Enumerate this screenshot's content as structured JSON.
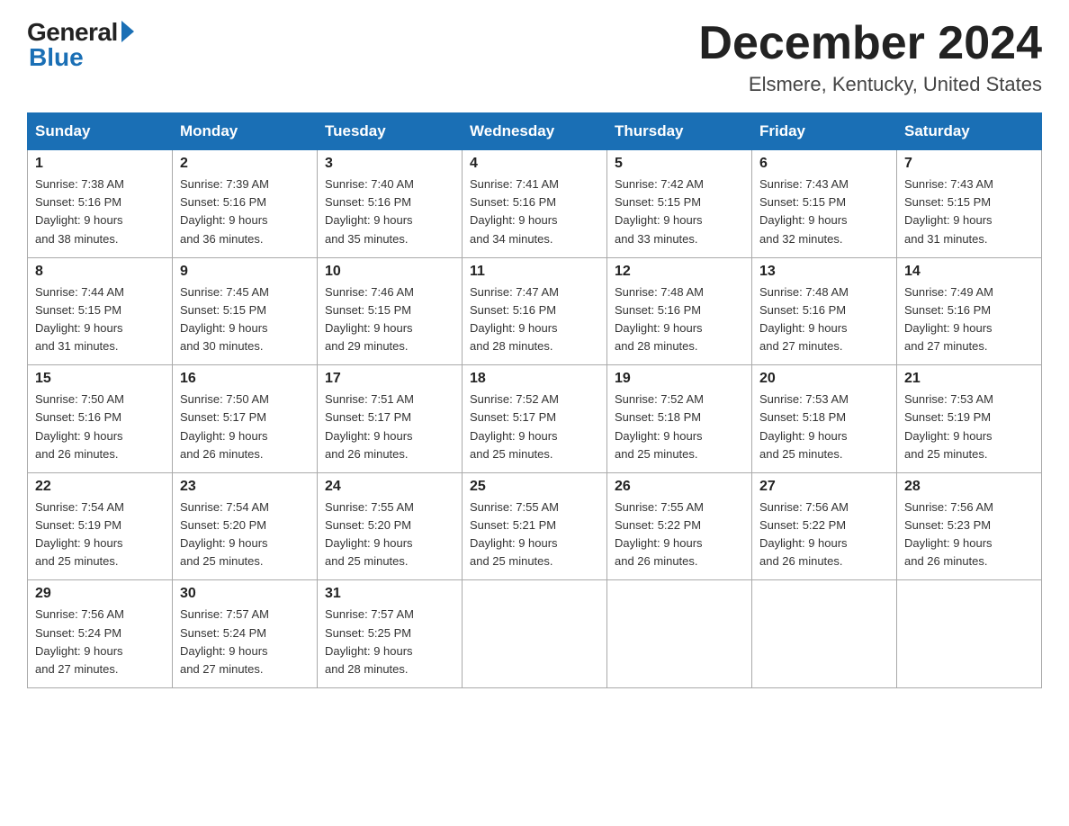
{
  "header": {
    "logo": {
      "general": "General",
      "blue": "Blue"
    },
    "month": "December 2024",
    "location": "Elsmere, Kentucky, United States"
  },
  "days_of_week": [
    "Sunday",
    "Monday",
    "Tuesday",
    "Wednesday",
    "Thursday",
    "Friday",
    "Saturday"
  ],
  "weeks": [
    [
      {
        "day": "1",
        "sunrise": "7:38 AM",
        "sunset": "5:16 PM",
        "daylight": "9 hours and 38 minutes."
      },
      {
        "day": "2",
        "sunrise": "7:39 AM",
        "sunset": "5:16 PM",
        "daylight": "9 hours and 36 minutes."
      },
      {
        "day": "3",
        "sunrise": "7:40 AM",
        "sunset": "5:16 PM",
        "daylight": "9 hours and 35 minutes."
      },
      {
        "day": "4",
        "sunrise": "7:41 AM",
        "sunset": "5:16 PM",
        "daylight": "9 hours and 34 minutes."
      },
      {
        "day": "5",
        "sunrise": "7:42 AM",
        "sunset": "5:15 PM",
        "daylight": "9 hours and 33 minutes."
      },
      {
        "day": "6",
        "sunrise": "7:43 AM",
        "sunset": "5:15 PM",
        "daylight": "9 hours and 32 minutes."
      },
      {
        "day": "7",
        "sunrise": "7:43 AM",
        "sunset": "5:15 PM",
        "daylight": "9 hours and 31 minutes."
      }
    ],
    [
      {
        "day": "8",
        "sunrise": "7:44 AM",
        "sunset": "5:15 PM",
        "daylight": "9 hours and 31 minutes."
      },
      {
        "day": "9",
        "sunrise": "7:45 AM",
        "sunset": "5:15 PM",
        "daylight": "9 hours and 30 minutes."
      },
      {
        "day": "10",
        "sunrise": "7:46 AM",
        "sunset": "5:15 PM",
        "daylight": "9 hours and 29 minutes."
      },
      {
        "day": "11",
        "sunrise": "7:47 AM",
        "sunset": "5:16 PM",
        "daylight": "9 hours and 28 minutes."
      },
      {
        "day": "12",
        "sunrise": "7:48 AM",
        "sunset": "5:16 PM",
        "daylight": "9 hours and 28 minutes."
      },
      {
        "day": "13",
        "sunrise": "7:48 AM",
        "sunset": "5:16 PM",
        "daylight": "9 hours and 27 minutes."
      },
      {
        "day": "14",
        "sunrise": "7:49 AM",
        "sunset": "5:16 PM",
        "daylight": "9 hours and 27 minutes."
      }
    ],
    [
      {
        "day": "15",
        "sunrise": "7:50 AM",
        "sunset": "5:16 PM",
        "daylight": "9 hours and 26 minutes."
      },
      {
        "day": "16",
        "sunrise": "7:50 AM",
        "sunset": "5:17 PM",
        "daylight": "9 hours and 26 minutes."
      },
      {
        "day": "17",
        "sunrise": "7:51 AM",
        "sunset": "5:17 PM",
        "daylight": "9 hours and 26 minutes."
      },
      {
        "day": "18",
        "sunrise": "7:52 AM",
        "sunset": "5:17 PM",
        "daylight": "9 hours and 25 minutes."
      },
      {
        "day": "19",
        "sunrise": "7:52 AM",
        "sunset": "5:18 PM",
        "daylight": "9 hours and 25 minutes."
      },
      {
        "day": "20",
        "sunrise": "7:53 AM",
        "sunset": "5:18 PM",
        "daylight": "9 hours and 25 minutes."
      },
      {
        "day": "21",
        "sunrise": "7:53 AM",
        "sunset": "5:19 PM",
        "daylight": "9 hours and 25 minutes."
      }
    ],
    [
      {
        "day": "22",
        "sunrise": "7:54 AM",
        "sunset": "5:19 PM",
        "daylight": "9 hours and 25 minutes."
      },
      {
        "day": "23",
        "sunrise": "7:54 AM",
        "sunset": "5:20 PM",
        "daylight": "9 hours and 25 minutes."
      },
      {
        "day": "24",
        "sunrise": "7:55 AM",
        "sunset": "5:20 PM",
        "daylight": "9 hours and 25 minutes."
      },
      {
        "day": "25",
        "sunrise": "7:55 AM",
        "sunset": "5:21 PM",
        "daylight": "9 hours and 25 minutes."
      },
      {
        "day": "26",
        "sunrise": "7:55 AM",
        "sunset": "5:22 PM",
        "daylight": "9 hours and 26 minutes."
      },
      {
        "day": "27",
        "sunrise": "7:56 AM",
        "sunset": "5:22 PM",
        "daylight": "9 hours and 26 minutes."
      },
      {
        "day": "28",
        "sunrise": "7:56 AM",
        "sunset": "5:23 PM",
        "daylight": "9 hours and 26 minutes."
      }
    ],
    [
      {
        "day": "29",
        "sunrise": "7:56 AM",
        "sunset": "5:24 PM",
        "daylight": "9 hours and 27 minutes."
      },
      {
        "day": "30",
        "sunrise": "7:57 AM",
        "sunset": "5:24 PM",
        "daylight": "9 hours and 27 minutes."
      },
      {
        "day": "31",
        "sunrise": "7:57 AM",
        "sunset": "5:25 PM",
        "daylight": "9 hours and 28 minutes."
      },
      null,
      null,
      null,
      null
    ]
  ],
  "labels": {
    "sunrise": "Sunrise:",
    "sunset": "Sunset:",
    "daylight": "Daylight:"
  }
}
